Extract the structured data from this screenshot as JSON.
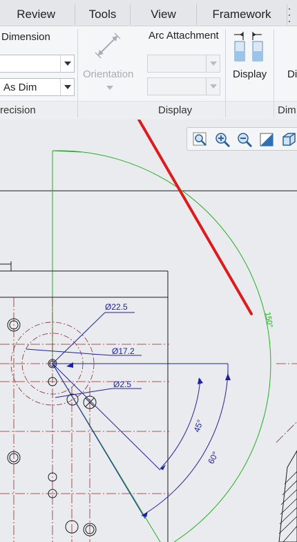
{
  "tabs": [
    {
      "label": "Review"
    },
    {
      "label": "Tools"
    },
    {
      "label": "View"
    },
    {
      "label": "Framework"
    }
  ],
  "ribbon": {
    "dimension_label": "Dimension",
    "as_dim_value": "As Dim",
    "precision_group": "recision",
    "orientation_label": "Orientation",
    "arc_attachment_label": "Arc Attachment",
    "display_button_label": "Display",
    "display_group": "Display",
    "dim_partial": "Di",
    "dim_group_partial": "Dim"
  },
  "view_toolbar": {
    "icons": [
      "zoom-fit-icon",
      "zoom-in-icon",
      "zoom-out-icon",
      "repaint-icon",
      "saved-views-icon"
    ]
  },
  "drawing": {
    "dims": {
      "d1": "Ø22.5",
      "d2": "Ø17.2",
      "d3": "Ø2.5",
      "a1": "45°",
      "a2": "60°",
      "a3": "150°"
    }
  },
  "colors": {
    "annotation_arrow": "#e0191b",
    "geometry": "#1a1a1a",
    "dimension": "#1f1fa8",
    "sketch": "#22b022",
    "centerline": "#8a2a2a"
  }
}
